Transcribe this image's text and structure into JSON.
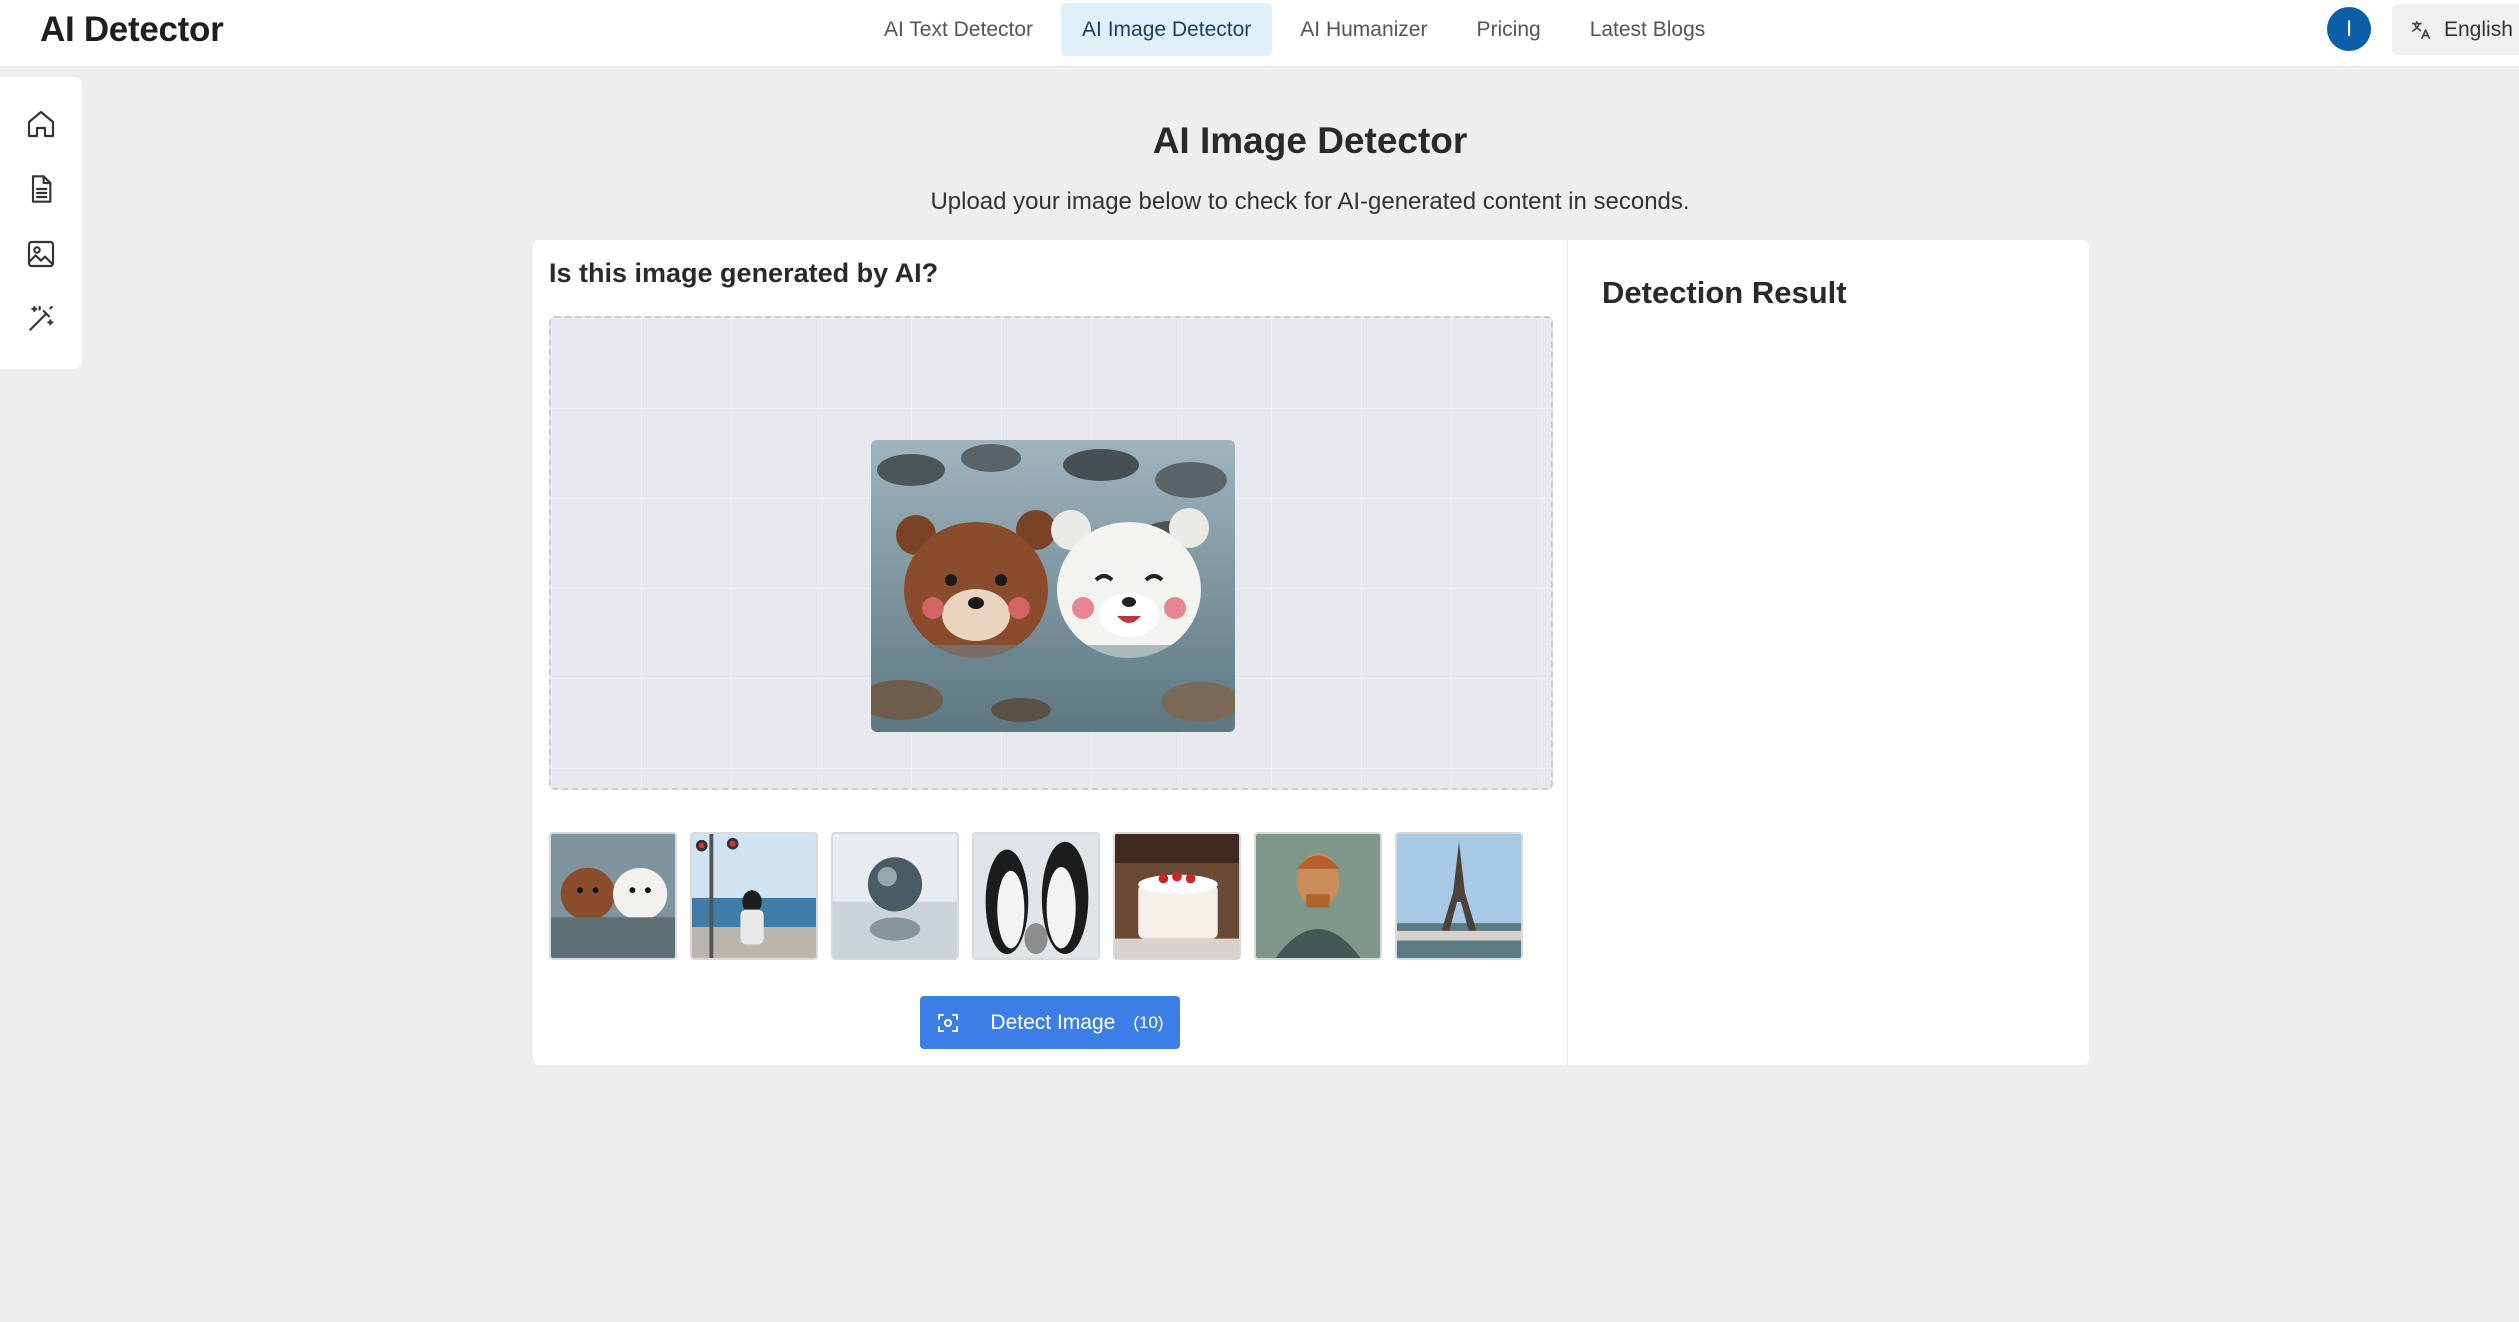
{
  "app": {
    "brand": "AI Detector"
  },
  "nav": {
    "items": [
      {
        "label": "AI Text Detector",
        "active": false
      },
      {
        "label": "AI Image Detector",
        "active": true
      },
      {
        "label": "AI Humanizer",
        "active": false
      },
      {
        "label": "Pricing",
        "active": false
      },
      {
        "label": "Latest Blogs",
        "active": false
      }
    ]
  },
  "user": {
    "avatar_initial": "I"
  },
  "language": {
    "label": "English",
    "icon": "translate-icon"
  },
  "sidebar": {
    "items": [
      {
        "icon": "home-icon"
      },
      {
        "icon": "document-icon"
      },
      {
        "icon": "image-icon"
      },
      {
        "icon": "magic-wand-icon"
      }
    ]
  },
  "page": {
    "title": "AI Image Detector",
    "subtitle": "Upload your image below to check for AI-generated content in seconds."
  },
  "detector": {
    "question": "Is this image generated by AI?",
    "preview_icon": "bears-in-water-image",
    "samples": [
      {
        "icon": "bears-thumbnail"
      },
      {
        "icon": "girl-by-sea-thumbnail"
      },
      {
        "icon": "crystal-ball-thumbnail"
      },
      {
        "icon": "penguins-thumbnail"
      },
      {
        "icon": "cake-thumbnail"
      },
      {
        "icon": "portrait-painting-thumbnail"
      },
      {
        "icon": "eiffel-tower-thumbnail"
      }
    ],
    "button": {
      "label": "Detect Image",
      "count": "(10)",
      "color": "#3b7fe5"
    }
  },
  "result": {
    "title": "Detection Result"
  },
  "colors": {
    "accent": "#3b7fe5",
    "nav_active_bg": "#dff0fb",
    "avatar_bg": "#0b5fa8"
  }
}
